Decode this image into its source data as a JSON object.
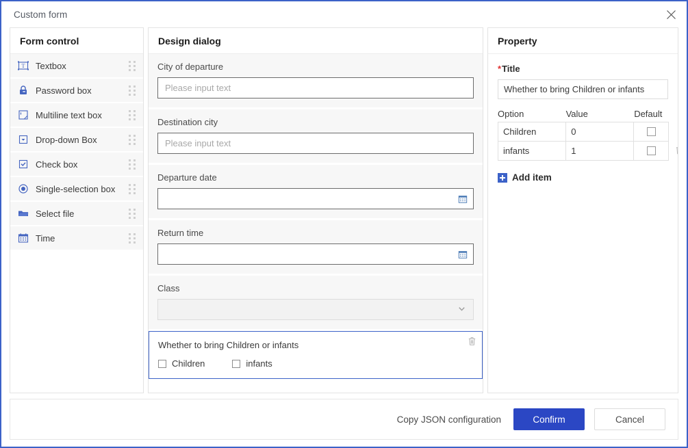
{
  "window": {
    "title": "Custom form",
    "close_icon": "close-icon",
    "accent_color": "#3c62c8"
  },
  "form_control_panel": {
    "header": "Form control",
    "items": [
      {
        "label": "Textbox",
        "icon": "textbox-icon"
      },
      {
        "label": "Password box",
        "icon": "lock-icon"
      },
      {
        "label": "Multiline text box",
        "icon": "multiline-textbox-icon"
      },
      {
        "label": "Drop-down Box",
        "icon": "dropdown-icon"
      },
      {
        "label": "Check box",
        "icon": "checkbox-icon"
      },
      {
        "label": "Single-selection box",
        "icon": "radio-icon"
      },
      {
        "label": "Select file",
        "icon": "folder-icon"
      },
      {
        "label": "Time",
        "icon": "calendar-icon"
      }
    ]
  },
  "design_dialog": {
    "header": "Design dialog",
    "fields": [
      {
        "label": "City of departure",
        "type": "text",
        "value": "",
        "placeholder": "Please input text"
      },
      {
        "label": "Destination city",
        "type": "text",
        "value": "",
        "placeholder": "Please input text"
      },
      {
        "label": "Departure date",
        "type": "date",
        "value": "",
        "placeholder": "",
        "suffix_icon": "calendar-icon"
      },
      {
        "label": "Return time",
        "type": "date",
        "value": "",
        "placeholder": "",
        "suffix_icon": "calendar-icon"
      },
      {
        "label": "Class",
        "type": "select",
        "value": "",
        "placeholder": "",
        "suffix_icon": "chevron-down-icon"
      }
    ],
    "selected_group": {
      "title": "Whether to bring Children or infants",
      "delete_icon": "trash-icon",
      "options": [
        {
          "label": "Children",
          "checked": false
        },
        {
          "label": "infants",
          "checked": false
        }
      ]
    }
  },
  "property_panel": {
    "header": "Property",
    "title_label": "Title",
    "title_required_marker": "*",
    "title_value": "Whether to bring Children or infants",
    "table": {
      "columns": [
        "Option",
        "Value",
        "Default"
      ],
      "rows": [
        {
          "option": "Children",
          "value": "0",
          "default": false,
          "deletable": false
        },
        {
          "option": "infants",
          "value": "1",
          "default": false,
          "deletable": true
        }
      ]
    },
    "add_item_label": "Add item",
    "add_item_icon": "plus-square-icon",
    "delete_icon": "trash-icon"
  },
  "footer": {
    "copy_json_label": "Copy JSON configuration",
    "confirm_label": "Confirm",
    "cancel_label": "Cancel"
  }
}
